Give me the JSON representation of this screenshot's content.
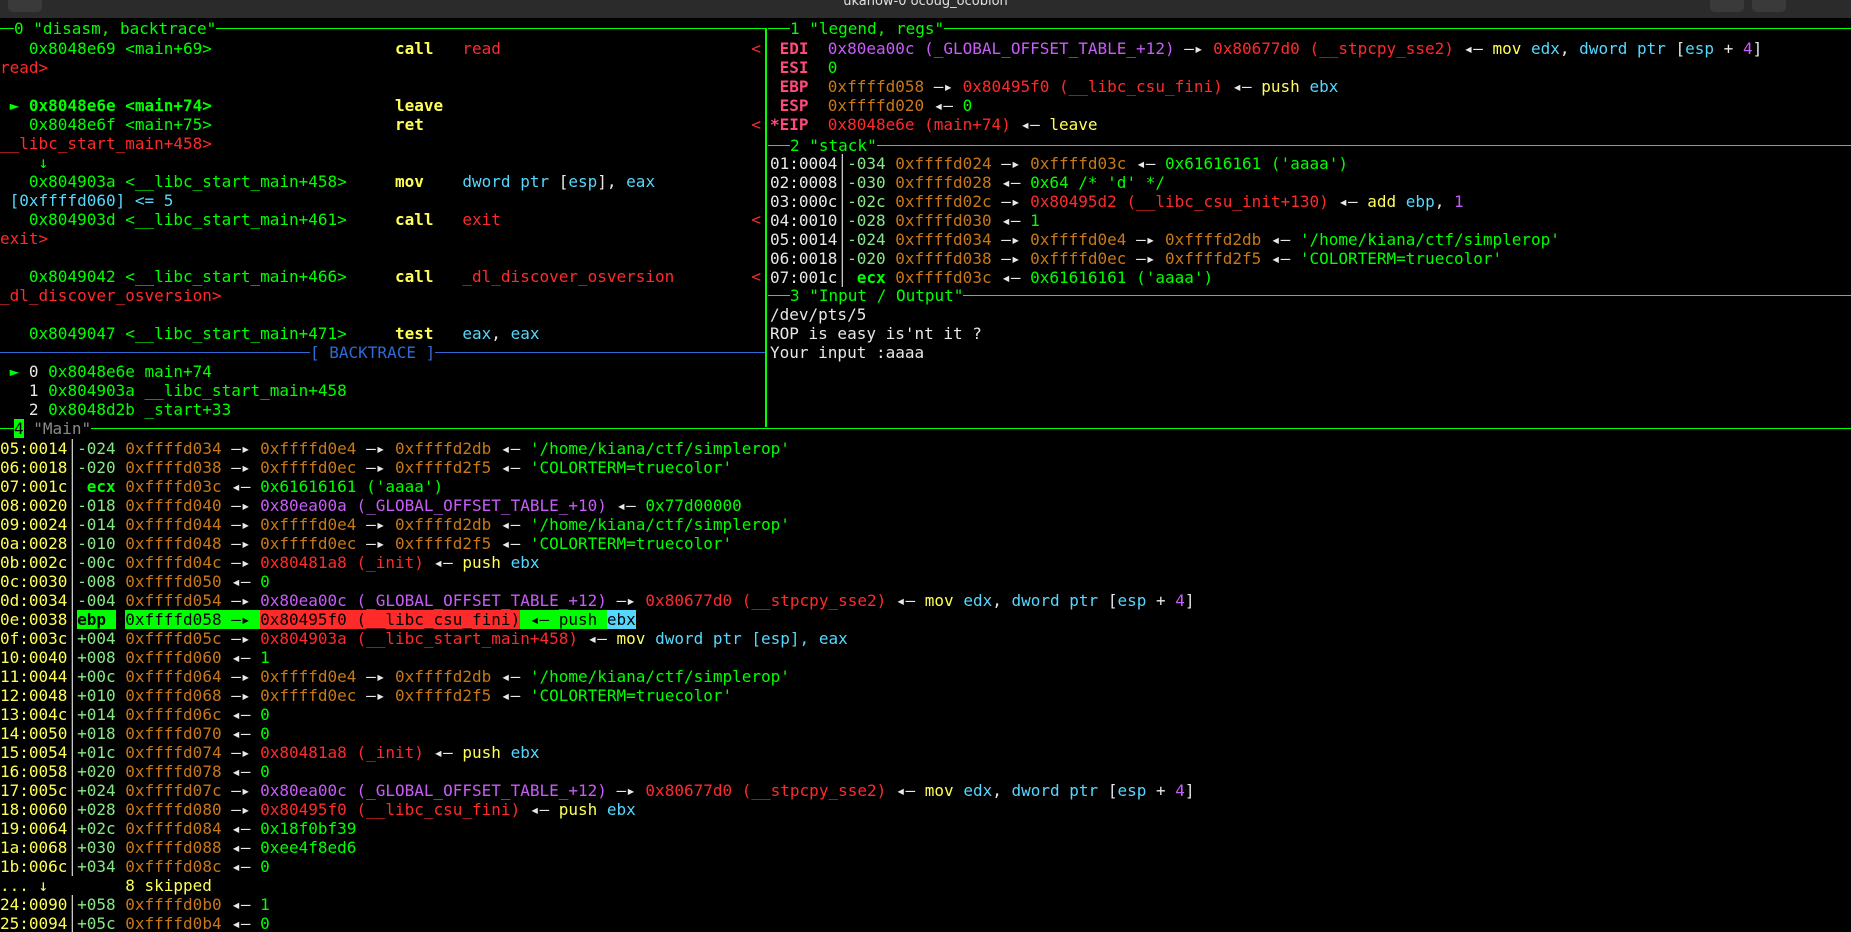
{
  "window": {
    "title": "ukanow-0 ocoug_ocobion"
  },
  "panes": {
    "disasm_title": "0 \"disasm, backtrace\"",
    "legend_title": "1 \"legend, regs\"",
    "stack_title": "2 \"stack\"",
    "io_title": "3 \"Input / Output\"",
    "main_title": "\"Main\"",
    "main_index": "4",
    "backtrace_title": "[ BACKTRACE ]"
  },
  "disasm": [
    {
      "addr": "0x8048e69",
      "sym": "<main+69>",
      "op": "call",
      "arg": "read",
      "cont": "read>"
    },
    {
      "addr": "0x8048e6e",
      "sym": "<main+74>",
      "op": "leave",
      "arg": "",
      "current": true
    },
    {
      "addr": "0x8048e6f",
      "sym": "<main+75>",
      "op": "ret",
      "arg": "",
      "cont": "__libc_start_main+458>"
    },
    {
      "addr": "0x804903a",
      "sym": "<__libc_start_main+458>",
      "op": "mov",
      "arg": "dword ptr [esp], eax",
      "cont": "[0xffffd060] <= 5"
    },
    {
      "addr": "0x804903d",
      "sym": "<__libc_start_main+461>",
      "op": "call",
      "arg": "exit",
      "cont": "exit>"
    },
    {
      "addr": "0x8049042",
      "sym": "<__libc_start_main+466>",
      "op": "call",
      "arg": "_dl_discover_osversion",
      "cont": "_dl_discover_osversion>"
    },
    {
      "addr": "0x8049047",
      "sym": "<__libc_start_main+471>",
      "op": "test",
      "arg": "eax, eax"
    }
  ],
  "down_arrow": "↓",
  "cur_marker": "►",
  "ret_marker": "<",
  "backtrace": [
    {
      "idx": "0",
      "text": "0x8048e6e main+74",
      "current": true
    },
    {
      "idx": "1",
      "text": "0x804903a __libc_start_main+458"
    },
    {
      "idx": "2",
      "text": "0x8048d2b _start+33"
    }
  ],
  "regs": {
    "edi": {
      "name": "EDI",
      "a": "0x80ea00c",
      "a_sym": "(_GLOBAL_OFFSET_TABLE_+12)",
      "b": "0x80677d0",
      "b_sym": "(__stpcpy_sse2)",
      "insn_op": "mov",
      "insn_r1": "edx",
      "insn_rest": "dword ptr [esp + 4]"
    },
    "esi": {
      "name": "ESI",
      "val": "0"
    },
    "ebp": {
      "name": "EBP",
      "a": "0xffffd058",
      "b": "0x80495f0",
      "b_sym": "(__libc_csu_fini)",
      "insn_op": "push",
      "insn_r1": "ebx"
    },
    "esp": {
      "name": "ESP",
      "a": "0xffffd020",
      "val": "0"
    },
    "eip": {
      "name": "*EIP",
      "a": "0x8048e6e",
      "a_sym": "(main+74)",
      "insn_op": "leave"
    }
  },
  "stack": [
    {
      "off": "01:0004",
      "rel": "-034",
      "addr": "0xffffd024",
      "p1": "0xffffd03c",
      "val": "0x61616161 ('aaaa')"
    },
    {
      "off": "02:0008",
      "rel": "-030",
      "addr": "0xffffd028",
      "val": "0x64 /* 'd' */"
    },
    {
      "off": "03:000c",
      "rel": "-02c",
      "addr": "0xffffd02c",
      "p1": "0x80495d2",
      "p1_sym": "(__libc_csu_init+130)",
      "insn_op": "add",
      "insn_r1": "ebp",
      "insn_rest": "1"
    },
    {
      "off": "04:0010",
      "rel": "-028",
      "addr": "0xffffd030",
      "val": "1"
    },
    {
      "off": "05:0014",
      "rel": "-024",
      "addr": "0xffffd034",
      "p1": "0xffffd0e4",
      "p2": "0xffffd2db",
      "val": "'/home/kiana/ctf/simplerop'"
    },
    {
      "off": "06:0018",
      "rel": "-020",
      "addr": "0xffffd038",
      "p1": "0xffffd0ec",
      "p2": "0xffffd2f5",
      "val": "'COLORTERM=truecolor'"
    },
    {
      "off": "07:001c",
      "rel": "ecx",
      "addr": "0xffffd03c",
      "val": "0x61616161 ('aaaa')"
    }
  ],
  "io": [
    "/dev/pts/5",
    "ROP is easy is'nt it ?",
    "Your input :aaaa"
  ],
  "main_stack": [
    {
      "off": "05:0014",
      "rel": "-024",
      "addr": "0xffffd034",
      "p1": "0xffffd0e4",
      "p2": "0xffffd2db",
      "val": "'/home/kiana/ctf/simplerop'"
    },
    {
      "off": "06:0018",
      "rel": "-020",
      "addr": "0xffffd038",
      "p1": "0xffffd0ec",
      "p2": "0xffffd2f5",
      "val": "'COLORTERM=truecolor'"
    },
    {
      "off": "07:001c",
      "rel": "ecx",
      "addr": "0xffffd03c",
      "val": "0x61616161 ('aaaa')"
    },
    {
      "off": "08:0020",
      "rel": "-018",
      "addr": "0xffffd040",
      "p1": "0x80ea00a",
      "p1_sym": "(_GLOBAL_OFFSET_TABLE_+10)",
      "val": "0x77d00000"
    },
    {
      "off": "09:0024",
      "rel": "-014",
      "addr": "0xffffd044",
      "p1": "0xffffd0e4",
      "p2": "0xffffd2db",
      "val": "'/home/kiana/ctf/simplerop'"
    },
    {
      "off": "0a:0028",
      "rel": "-010",
      "addr": "0xffffd048",
      "p1": "0xffffd0ec",
      "p2": "0xffffd2f5",
      "val": "'COLORTERM=truecolor'"
    },
    {
      "off": "0b:002c",
      "rel": "-00c",
      "addr": "0xffffd04c",
      "p1": "0x80481a8",
      "p1_sym": "(_init)",
      "insn_op": "push",
      "insn_r1": "ebx"
    },
    {
      "off": "0c:0030",
      "rel": "-008",
      "addr": "0xffffd050",
      "val": "0"
    },
    {
      "off": "0d:0034",
      "rel": "-004",
      "addr": "0xffffd054",
      "p1": "0x80ea00c",
      "p1_sym": "(_GLOBAL_OFFSET_TABLE_+12)",
      "p2": "0x80677d0",
      "p2_sym": "(__stpcpy_sse2)",
      "insn_op": "mov",
      "insn_r1": "edx",
      "insn_rest": "dword ptr [esp + 4]"
    },
    {
      "off": "0e:0038",
      "rel": "ebp",
      "addr": "0xffffd058",
      "p1": "0x80495f0",
      "p1_sym": "(__libc_csu_fini)",
      "insn_op": "push",
      "insn_r1": "ebx",
      "highlight": true
    },
    {
      "off": "0f:003c",
      "rel": "+004",
      "addr": "0xffffd05c",
      "p1": "0x804903a",
      "p1_sym": "(__libc_start_main+458)",
      "insn_op": "mov",
      "insn_r1": "dword ptr [esp], eax"
    },
    {
      "off": "10:0040",
      "rel": "+008",
      "addr": "0xffffd060",
      "val": "1"
    },
    {
      "off": "11:0044",
      "rel": "+00c",
      "addr": "0xffffd064",
      "p1": "0xffffd0e4",
      "p2": "0xffffd2db",
      "val": "'/home/kiana/ctf/simplerop'"
    },
    {
      "off": "12:0048",
      "rel": "+010",
      "addr": "0xffffd068",
      "p1": "0xffffd0ec",
      "p2": "0xffffd2f5",
      "val": "'COLORTERM=truecolor'"
    },
    {
      "off": "13:004c",
      "rel": "+014",
      "addr": "0xffffd06c",
      "val": "0"
    },
    {
      "off": "14:0050",
      "rel": "+018",
      "addr": "0xffffd070",
      "val": "0"
    },
    {
      "off": "15:0054",
      "rel": "+01c",
      "addr": "0xffffd074",
      "p1": "0x80481a8",
      "p1_sym": "(_init)",
      "insn_op": "push",
      "insn_r1": "ebx"
    },
    {
      "off": "16:0058",
      "rel": "+020",
      "addr": "0xffffd078",
      "val": "0"
    },
    {
      "off": "17:005c",
      "rel": "+024",
      "addr": "0xffffd07c",
      "p1": "0x80ea00c",
      "p1_sym": "(_GLOBAL_OFFSET_TABLE_+12)",
      "p2": "0x80677d0",
      "p2_sym": "(__stpcpy_sse2)",
      "insn_op": "mov",
      "insn_r1": "edx",
      "insn_rest": "dword ptr [esp + 4]"
    },
    {
      "off": "18:0060",
      "rel": "+028",
      "addr": "0xffffd080",
      "p1": "0x80495f0",
      "p1_sym": "(__libc_csu_fini)",
      "insn_op": "push",
      "insn_r1": "ebx"
    },
    {
      "off": "19:0064",
      "rel": "+02c",
      "addr": "0xffffd084",
      "val": "0x18f0bf39"
    },
    {
      "off": "1a:0068",
      "rel": "+030",
      "addr": "0xffffd088",
      "val": "0xee4f8ed6"
    },
    {
      "off": "1b:006c",
      "rel": "+034",
      "addr": "0xffffd08c",
      "val": "0"
    },
    {
      "skip": true,
      "text": "... ↓        8 skipped"
    },
    {
      "off": "24:0090",
      "rel": "+058",
      "addr": "0xffffd0b0",
      "val": "1"
    },
    {
      "off": "25:0094",
      "rel": "+05c",
      "addr": "0xffffd0b4",
      "val": "0"
    }
  ],
  "arrows": {
    "ptr": "—▸",
    "val": "◂—"
  }
}
